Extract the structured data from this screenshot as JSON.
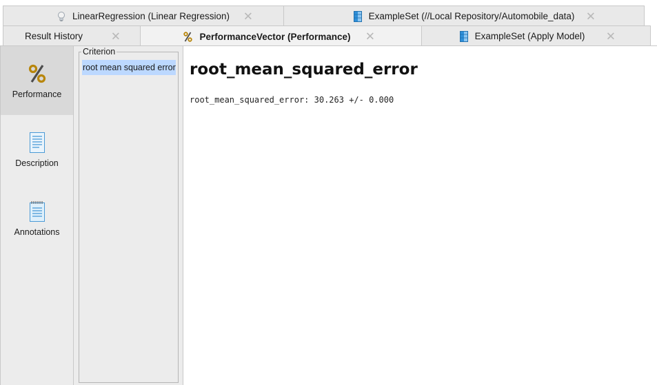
{
  "tabs_row1": [
    {
      "label": "LinearRegression (Linear Regression)",
      "icon": "lightbulb-icon"
    },
    {
      "label": "ExampleSet (//Local Repository/Automobile_data)",
      "icon": "exampleset-icon"
    }
  ],
  "tabs_row2": [
    {
      "label": "Result History"
    },
    {
      "label": "PerformanceVector (Performance)",
      "icon": "percent-icon",
      "active": true
    },
    {
      "label": "ExampleSet (Apply Model)",
      "icon": "exampleset-icon"
    }
  ],
  "close_glyph": "✕",
  "nav": {
    "items": [
      {
        "label": "Performance",
        "icon": "percent-icon",
        "selected": true
      },
      {
        "label": "Description",
        "icon": "document-icon"
      },
      {
        "label": "Annotations",
        "icon": "notepad-icon"
      }
    ]
  },
  "criterion": {
    "legend": "Criterion",
    "items": [
      "root mean squared error"
    ]
  },
  "main": {
    "title": "root_mean_squared_error",
    "value_line": "root_mean_squared_error: 30.263 +/- 0.000"
  },
  "colors": {
    "selection": "#bcd8ff",
    "panel_bg": "#ececec",
    "exampleset_icon": "#2f8fd8",
    "percent_icon": "#b8860b"
  }
}
